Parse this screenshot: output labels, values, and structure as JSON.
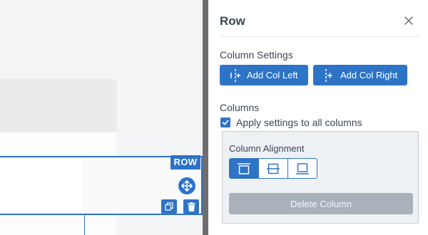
{
  "canvas": {
    "row_label": "ROW"
  },
  "panel": {
    "title": "Row",
    "column_settings": {
      "heading": "Column Settings",
      "add_col_left": "Add Col Left",
      "add_col_right": "Add Col Right"
    },
    "columns": {
      "heading": "Columns",
      "apply_all_label": "Apply settings to all columns",
      "apply_all_checked": true,
      "alignment": {
        "heading": "Column Alignment",
        "options": [
          "align-top-icon",
          "align-center-icon",
          "align-bottom-icon"
        ],
        "selected": "align-top-icon"
      },
      "delete_label": "Delete Column"
    }
  },
  "colors": {
    "accent": "#2d73c6",
    "splitter": "#6e6e70",
    "disabled_button": "#a9b2bb"
  }
}
